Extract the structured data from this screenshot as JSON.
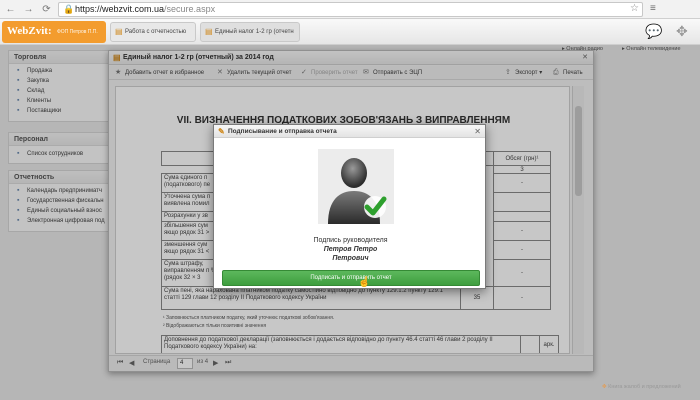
{
  "browser": {
    "url_host": "https://webzvit.com.ua",
    "url_path": "/secure.aspx"
  },
  "app": {
    "brand": "WebZvit:",
    "org": "ФОП Петров П.П.",
    "tabs": [
      {
        "label": "Работа с отчетностью"
      },
      {
        "label": "Единый налог 1-2 гр (отчетн"
      }
    ],
    "header_links": {
      "radio": "Онлайн радио",
      "tv": "Онлайн телевидение"
    }
  },
  "sidebar": {
    "sections": [
      {
        "title": "Торговля",
        "items": [
          "Продажа",
          "Закупка",
          "Склад",
          "Клиенты",
          "Поставщики"
        ]
      },
      {
        "title": "Персонал",
        "items": [
          "Список сотрудников"
        ]
      },
      {
        "title": "Отчетность",
        "items": [
          "Календарь предприниматч",
          "Государственная фискальн",
          "Единый социальный взнос",
          "Электронная цифровая под"
        ]
      }
    ]
  },
  "doc": {
    "title": "Единый налог 1-2 гр (отчетный) за 2014 год",
    "toolbar": {
      "add_fav": "Добавить отчет в избранное",
      "delete": "Удалить текущий отчет",
      "check": "Проверить отчет",
      "send": "Отправить с ЭЦП",
      "export": "Экспорт",
      "print": "Печать"
    },
    "heading": "VII. ВИЗНАЧЕННЯ ПОДАТКОВИХ ЗОБОВ'ЯЗАНЬ З ВИПРАВЛЕННЯМ",
    "volume_header": "Обсяг (грн)¹",
    "col_num": "3",
    "rows": [
      {
        "text": "Сума єдиного п (податкового) пе",
        "value": "-"
      },
      {
        "text": "Уточнена сума п виявлена помил",
        "value": ""
      },
      {
        "text": "Розрахунки у зв",
        "value": ""
      },
      {
        "text": "збільшення сум якщо рядок 31 >",
        "value": "-"
      },
      {
        "text": "зменшення сум якщо рядок 31 <",
        "value": "-"
      },
      {
        "text": "Сума штрафу, виправленням п % (рядок 32 × 3",
        "value": "-"
      },
      {
        "text": "Сума пені, яка нарахована платником податку самостійно відповідно до пункту 129.1.2 пункту 129.1 статті 129 глави 12 розділу ІІ Податкового кодексу України",
        "code": "35",
        "value": "-"
      }
    ],
    "notes": [
      "¹ Заповнюється платником податку, який уточнює податкові зобов'язання.",
      "² Відображаються тільки позитивні значення"
    ],
    "addition": "Доповнення до податкової декларації (заповнюється і додається відповідно до пункту 46.4 статті 46 глави 2 розділу ІІ Податкового кодексу України) на:",
    "addition_col": "арк.",
    "pager": {
      "label": "Страница",
      "page": "4",
      "of": "из 4"
    }
  },
  "modal": {
    "title": "Подписывание и отправка отчета",
    "sign_label": "Подпись руководителя",
    "name_line1": "Петров Петро",
    "name_line2": "Петрович",
    "button": "Подписать и отправить отчет"
  },
  "footer_link": "Книга жалоб и предложений",
  "colors": {
    "accent": "#f39c2e",
    "primary": "#4cae4c"
  }
}
